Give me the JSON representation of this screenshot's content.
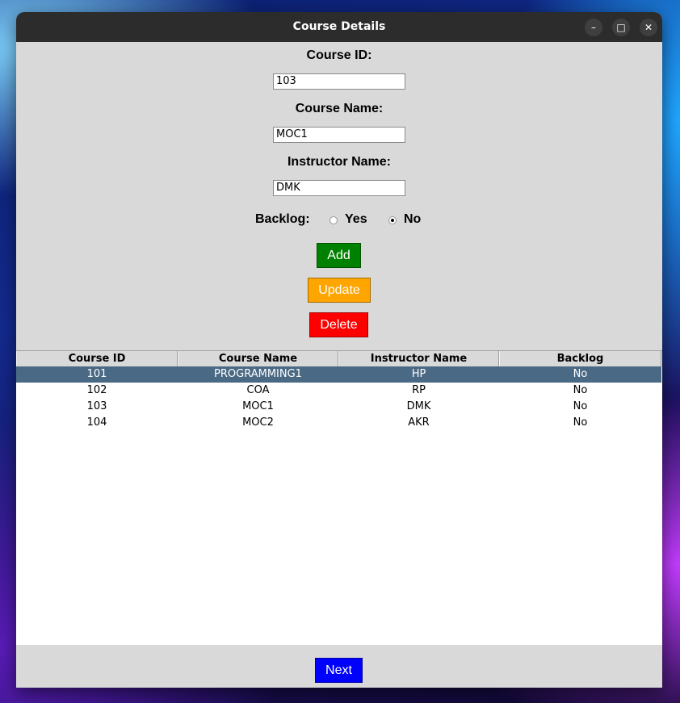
{
  "window": {
    "title": "Course Details",
    "controls": {
      "minimize": "–",
      "maximize": "□",
      "close": "✕"
    }
  },
  "form": {
    "course_id_label": "Course ID:",
    "course_id_value": "103",
    "course_name_label": "Course Name:",
    "course_name_value": "MOC1",
    "instructor_label": "Instructor Name:",
    "instructor_value": "DMK",
    "backlog_label": "Backlog:",
    "backlog_yes": "Yes",
    "backlog_no": "No",
    "backlog_selected": "No"
  },
  "buttons": {
    "add": "Add",
    "update": "Update",
    "delete": "Delete",
    "next": "Next"
  },
  "colors": {
    "add": "#008000",
    "update": "#ffa500",
    "delete": "#ff0000",
    "next": "#0000ff",
    "selected_row": "#4a6984"
  },
  "table": {
    "columns": [
      "Course ID",
      "Course Name",
      "Instructor Name",
      "Backlog"
    ],
    "rows": [
      [
        "101",
        "PROGRAMMING1",
        "HP",
        "No"
      ],
      [
        "102",
        "COA",
        "RP",
        "No"
      ],
      [
        "103",
        "MOC1",
        "DMK",
        "No"
      ],
      [
        "104",
        "MOC2",
        "AKR",
        "No"
      ]
    ],
    "selected_row": "101"
  }
}
